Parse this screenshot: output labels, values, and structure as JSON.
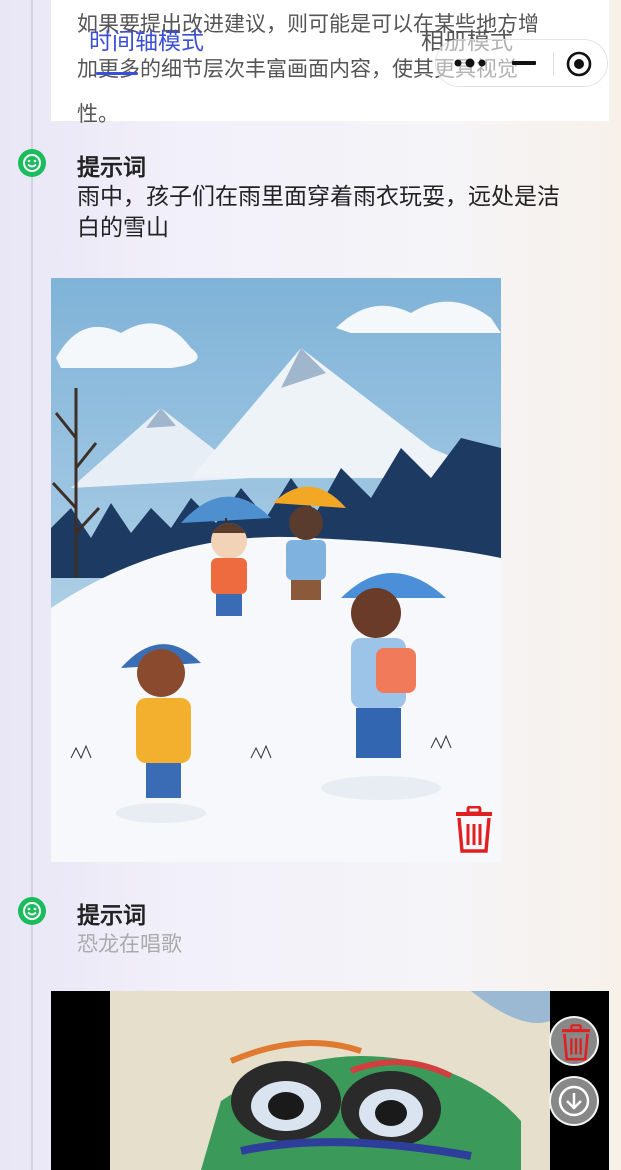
{
  "header": {
    "tabs": [
      {
        "label": "时间轴模式",
        "active": true
      },
      {
        "label": "相册模式",
        "active": false
      }
    ],
    "capsule_icons": [
      "more-dots-icon",
      "minimize-icon",
      "target-icon"
    ]
  },
  "text_card": {
    "lines": [
      "如果要提出改进建议，则可能是可以在某些地方增",
      "加更多的细节层次丰富画面内容，使其更具视觉",
      "性。"
    ]
  },
  "entries": [
    {
      "label": "提示词",
      "prompt": "雨中，孩子们在雨里面穿着雨衣玩耍，远处是洁白的雪山",
      "image": "children-in-rain-snow-mountains",
      "icons": [
        "smiley-icon",
        "trash-icon"
      ]
    },
    {
      "label": "提示词",
      "prompt": "恐龙在唱歌",
      "image": "crayon-dinosaur-face",
      "icons": [
        "smiley-icon"
      ]
    }
  ],
  "floating_actions": [
    "trash-icon",
    "download-arrow-icon"
  ],
  "colors": {
    "accent": "#3b4fd6",
    "smiley": "#1bbc5c",
    "trash": "#e02020",
    "label_muted": "#aaaaaa"
  }
}
